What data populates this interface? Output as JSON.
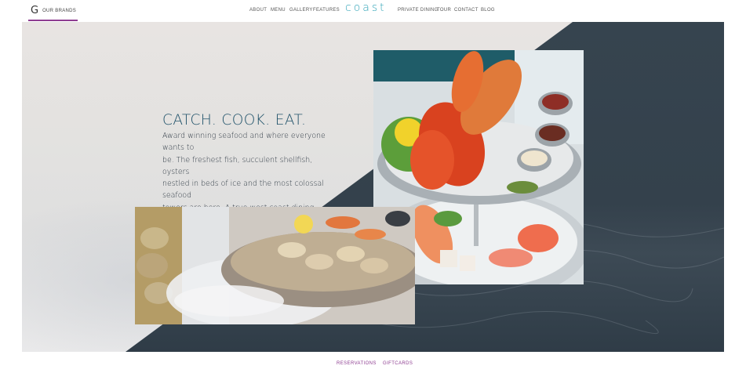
{
  "header": {
    "brands_logo": "G",
    "brands_label": "OUR BRANDS",
    "nav_left": [
      "ABOUT",
      "MENU",
      "GALLERY",
      "FEATURES"
    ],
    "logo_text": "coast",
    "nav_right": [
      "PRIVATE DINING",
      "TOUR",
      "CONTACT",
      "BLOG"
    ]
  },
  "hero": {
    "headline": "CATCH. COOK. EAT.",
    "body_line_1": "Award winning seafood and where everyone wants to",
    "body_line_2": "be. The freshest fish, succulent shellfish, oysters",
    "body_line_3": "nestled in beds of ice and the most colossal seafood",
    "body_line_4": "towers are here. A true west coast dining experience."
  },
  "footer": {
    "reservations": "RESERVATIONS",
    "giftcards": "GIFTCARDS"
  },
  "colors": {
    "accent": "#8e3d91",
    "logo": "#2da2b6",
    "headline": "#1f5169",
    "dark_panel": "#34414c"
  }
}
